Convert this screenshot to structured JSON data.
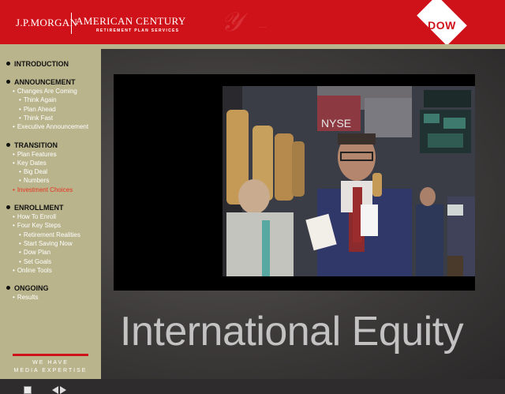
{
  "header": {
    "logo_jpm": "J.P.MORGAN",
    "logo_ac": "AMERICAN CENTURY",
    "logo_sub": "RETIREMENT PLAN SERVICES",
    "dow": "DOW"
  },
  "sidebar": {
    "sections": [
      {
        "title": "INTRODUCTION",
        "items": []
      },
      {
        "title": "ANNOUNCEMENT",
        "items": [
          {
            "label": "Changes Are Coming",
            "level": 1
          },
          {
            "label": "Think Again",
            "level": 2
          },
          {
            "label": "Plan Ahead",
            "level": 2
          },
          {
            "label": "Think Fast",
            "level": 2
          },
          {
            "label": "Executive Announcement",
            "level": 1
          }
        ]
      },
      {
        "title": "TRANSITION",
        "items": [
          {
            "label": "Plan Features",
            "level": 1
          },
          {
            "label": "Key Dates",
            "level": 1
          },
          {
            "label": "Big Deal",
            "level": 2
          },
          {
            "label": "Numbers",
            "level": 2
          },
          {
            "label": "Investment Choices",
            "level": 1,
            "active": true
          }
        ]
      },
      {
        "title": "ENROLLMENT",
        "items": [
          {
            "label": "How To Enroll",
            "level": 1
          },
          {
            "label": "Four Key Steps",
            "level": 1
          },
          {
            "label": "Retirement Realities",
            "level": 2
          },
          {
            "label": "Start Saving Now",
            "level": 2
          },
          {
            "label": "Dow Plan",
            "level": 2
          },
          {
            "label": "Set Goals",
            "level": 2
          },
          {
            "label": "Online Tools",
            "level": 1
          }
        ]
      },
      {
        "title": "ONGOING",
        "items": [
          {
            "label": "Results",
            "level": 1
          }
        ]
      }
    ],
    "tagline_1": "WE HAVE",
    "tagline_2": "MEDIA EXPERTISE"
  },
  "main": {
    "title": "International Equity",
    "photo": {
      "sign": "NYSE"
    }
  },
  "colors": {
    "brand_red": "#cf1219",
    "sidebar_bg": "#b9b48c",
    "active_item": "#e8321f"
  }
}
